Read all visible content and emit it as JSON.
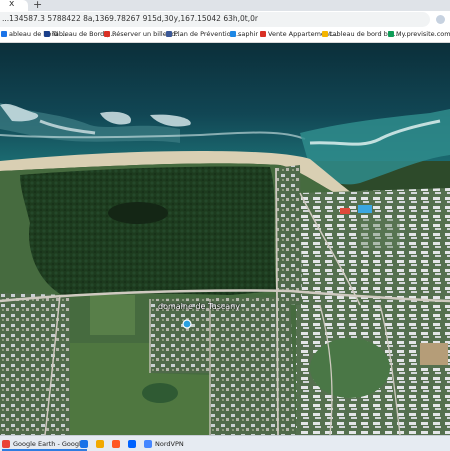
{
  "browser": {
    "url": "...134587.3 5788422 8a,1369.78267 915d,30y,167.15042 63h,0t,0r",
    "new_tab_symbol": "+",
    "close_symbol": "x"
  },
  "bookmarks": [
    {
      "label": "ableau de bord ...",
      "color": "#1a73e8"
    },
    {
      "label": "Tableau de Bord |...",
      "color": "#1a3f8a"
    },
    {
      "label": "Réserver un billet d...",
      "color": "#d93025"
    },
    {
      "label": "Plan de Prévention...",
      "color": "#3b5998"
    },
    {
      "label": "saphir",
      "color": "#1e88e5"
    },
    {
      "label": "Vente Appartement...",
      "color": "#d93025"
    },
    {
      "label": "tableau de bord bie...",
      "color": "#f4b400"
    },
    {
      "label": "My.previsite.com",
      "color": "#0f9d58"
    }
  ],
  "map": {
    "place_label": "domaine de Tuscany",
    "place_marker_color": "#2aa0e0"
  },
  "taskbar": [
    {
      "label": "Google Earth - Googl...",
      "color": "#ea4335",
      "icon": "chrome-icon"
    },
    {
      "label": "",
      "color": "#1a73e8",
      "icon": "app-icon"
    },
    {
      "label": "",
      "color": "#f2a900",
      "icon": "folder-icon"
    },
    {
      "label": "",
      "color": "#ff5722",
      "icon": "brave-icon"
    },
    {
      "label": "",
      "color": "#0063ff",
      "icon": "nordvpn-icon"
    },
    {
      "label": "NordVPN",
      "color": "#4687ff",
      "icon": "nordvpn-app-icon"
    }
  ]
}
